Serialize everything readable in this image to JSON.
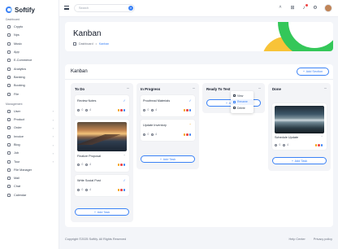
{
  "app": {
    "name": "Softify"
  },
  "header": {
    "search_placeholder": "Search",
    "search_button": "⌕"
  },
  "sidebar": {
    "section_main": "Dashboard",
    "main_items": [
      {
        "label": "Crypto",
        "caret": ""
      },
      {
        "label": "Nps",
        "caret": ""
      },
      {
        "label": "Music",
        "caret": ""
      },
      {
        "label": "App",
        "caret": ""
      },
      {
        "label": "E-Commerce",
        "caret": ""
      },
      {
        "label": "Analytics",
        "caret": ""
      },
      {
        "label": "Banking",
        "caret": ""
      },
      {
        "label": "Booking",
        "caret": ""
      },
      {
        "label": "File",
        "caret": ""
      }
    ],
    "section_mgmt": "Management",
    "mgmt_items": [
      {
        "label": "User",
        "caret": "›"
      },
      {
        "label": "Product",
        "caret": "›"
      },
      {
        "label": "Order",
        "caret": "›"
      },
      {
        "label": "Invoice",
        "caret": "›"
      },
      {
        "label": "Blog",
        "caret": "›"
      },
      {
        "label": "Job",
        "caret": "›"
      },
      {
        "label": "Tour",
        "caret": "›"
      },
      {
        "label": "File Manager",
        "caret": ""
      },
      {
        "label": "Mail",
        "caret": ""
      },
      {
        "label": "Chat",
        "caret": ""
      },
      {
        "label": "Calendar",
        "caret": ""
      }
    ]
  },
  "page": {
    "title": "Kanban",
    "breadcrumb_home": "Dashboard",
    "breadcrumb_sep": "•",
    "breadcrumb_current": "Kanban"
  },
  "board": {
    "title": "Kanban",
    "add_section": "Add Section",
    "add_task": "Add Task",
    "plus": "+",
    "columns": [
      {
        "title": "To Do",
        "menu": "···",
        "cards": [
          {
            "title": "Review Notes",
            "flag": "✓",
            "meta1": "0",
            "meta2": "4"
          },
          {
            "title": "Finalize Proposal",
            "flag": "⌃",
            "meta1": "0",
            "meta2": "4"
          },
          {
            "title": "Write Social Post",
            "flag": "✓",
            "meta1": "0",
            "meta2": "4"
          }
        ]
      },
      {
        "title": "In Progress",
        "menu": "···",
        "cards": [
          {
            "title": "Proofread Materials",
            "flag": "✓",
            "meta1": "0",
            "meta2": "4"
          },
          {
            "title": "Update Inventory",
            "flag": "⌃",
            "meta1": "0",
            "meta2": "4"
          }
        ]
      },
      {
        "title": "Ready To Test",
        "menu": "···",
        "cards": []
      },
      {
        "title": "Done",
        "menu": "···",
        "cards": [
          {
            "title": "Schedule Update",
            "flag": "⌃",
            "meta1": "0",
            "meta2": "4"
          }
        ]
      }
    ]
  },
  "menu_popup": {
    "items": [
      {
        "label": "View"
      },
      {
        "label": "Rename"
      },
      {
        "label": "Delete"
      }
    ]
  },
  "footer": {
    "copyright": "Copyright ©2025 Softify. All Rights Reserved",
    "help": "Help Center",
    "privacy": "Privacy policy"
  },
  "colors": {
    "accent": "#3b82f6",
    "success": "#34c759",
    "warning": "#f8c338"
  }
}
